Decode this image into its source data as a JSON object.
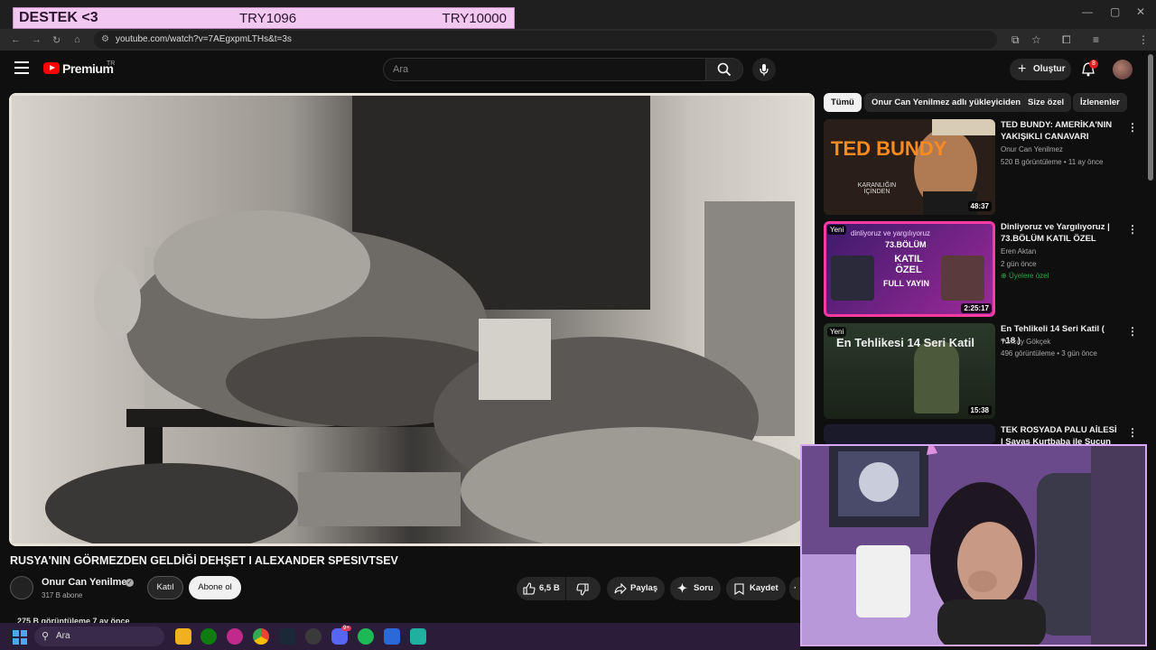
{
  "overlay": {
    "left": "DESTEK <3",
    "middle": "TRY1096",
    "right": "TRY10000"
  },
  "browser": {
    "url": "youtube.com/watch?v=7AEgxpmLTHs&t=3s"
  },
  "header": {
    "brand": "Premium",
    "country": "TR",
    "search_placeholder": "Ara",
    "create_label": "Oluştur",
    "notifications": "8"
  },
  "video": {
    "title": "RUSYA'NIN GÖRMEZDEN GELDİĞİ DEHŞET I ALEXANDER SPESIVTSEV",
    "channel": "Onur Can Yenilmez",
    "subscribers": "317 B abone",
    "join_label": "Katıl",
    "subscribe_label": "Abone ol",
    "likes": "6,5 B",
    "share_label": "Paylaş",
    "ask_label": "Soru",
    "save_label": "Kaydet",
    "views_line": "275 B görüntüleme  7 ay önce"
  },
  "chips": [
    "Tümü",
    "Onur Can Yenilmez adlı yükleyiciden",
    "Size özel",
    "İzlenenler"
  ],
  "related": [
    {
      "title": "TED BUNDY: AMERİKA'NIN YAKIŞIKLI CANAVARI",
      "channel": "Onur Can Yenilmez",
      "meta": "520 B görüntüleme • 11 ay önce",
      "duration": "48:37",
      "thumb_text": "TED BUNDY",
      "thumb_sub": "KARANLIĞIN İÇİNDEN"
    },
    {
      "title": "Dinliyoruz ve Yargılıyoruz | 73.BÖLÜM KATIL ÖZEL",
      "channel": "Eren Aktan",
      "meta": "2 gün önce",
      "members": "Üyelere özel",
      "duration": "2:25:17",
      "badge": "Yeni",
      "thumb_top": "dinliyoruz ve yargılıyoruz",
      "thumb_ep": "73.BÖLÜM",
      "thumb_main": "KATIL ÖZEL",
      "thumb_sub": "FULL YAYIN"
    },
    {
      "title": "En Tehlikeli 14 Seri Katil ( +18 )",
      "channel": "Tuncay Gökçek",
      "meta": "496 görüntüleme • 3 gün önce",
      "duration": "15:38",
      "badge": "Yeni",
      "thumb_text": "En Tehlikesi 14 Seri Katil"
    },
    {
      "title": "TEK ROSYADA PALU AİLESİ | Savaş Kurtbaba ile Suçun ..."
    }
  ],
  "taskbar": {
    "search_placeholder": "Ara",
    "discord_badge": "9+"
  },
  "colors": {
    "accent": "#ff0000",
    "subscribe_bg": "#f1f1f1",
    "chip_bg": "#272727",
    "members_green": "#2ba640"
  }
}
